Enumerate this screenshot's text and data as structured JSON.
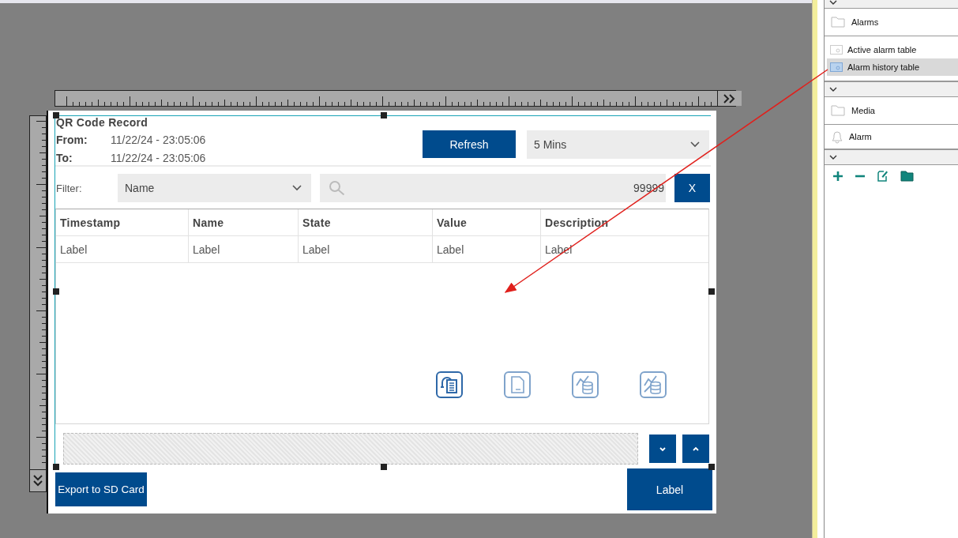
{
  "screen": {
    "title": "QR Code Record",
    "from": {
      "label": "From:",
      "value": "11/22/24 - 23:05:06"
    },
    "to": {
      "label": "To:",
      "value": "11/22/24 - 23:05:06"
    },
    "refresh_button": "Refresh",
    "interval": {
      "value": "5 Mins"
    },
    "filter": {
      "label": "Filter:",
      "field": "Name",
      "search_value": "99999",
      "clear_button": "X"
    },
    "table": {
      "columns": [
        "Timestamp",
        "Name",
        "State",
        "Value",
        "Description"
      ],
      "rows": [
        [
          "Label",
          "Label",
          "Label",
          "Label",
          "Label"
        ]
      ]
    },
    "export_button": "Export to SD Card",
    "label_button": "Label"
  },
  "panel": {
    "sections": [
      {
        "kind": "folder",
        "label": "Alarms",
        "items": [
          {
            "label": "Active alarm table",
            "selected": false
          },
          {
            "label": "Alarm history table",
            "selected": true
          }
        ]
      },
      {
        "kind": "folder",
        "label": "Media",
        "items": [
          {
            "label": "Alarm",
            "selected": false
          }
        ]
      }
    ]
  }
}
